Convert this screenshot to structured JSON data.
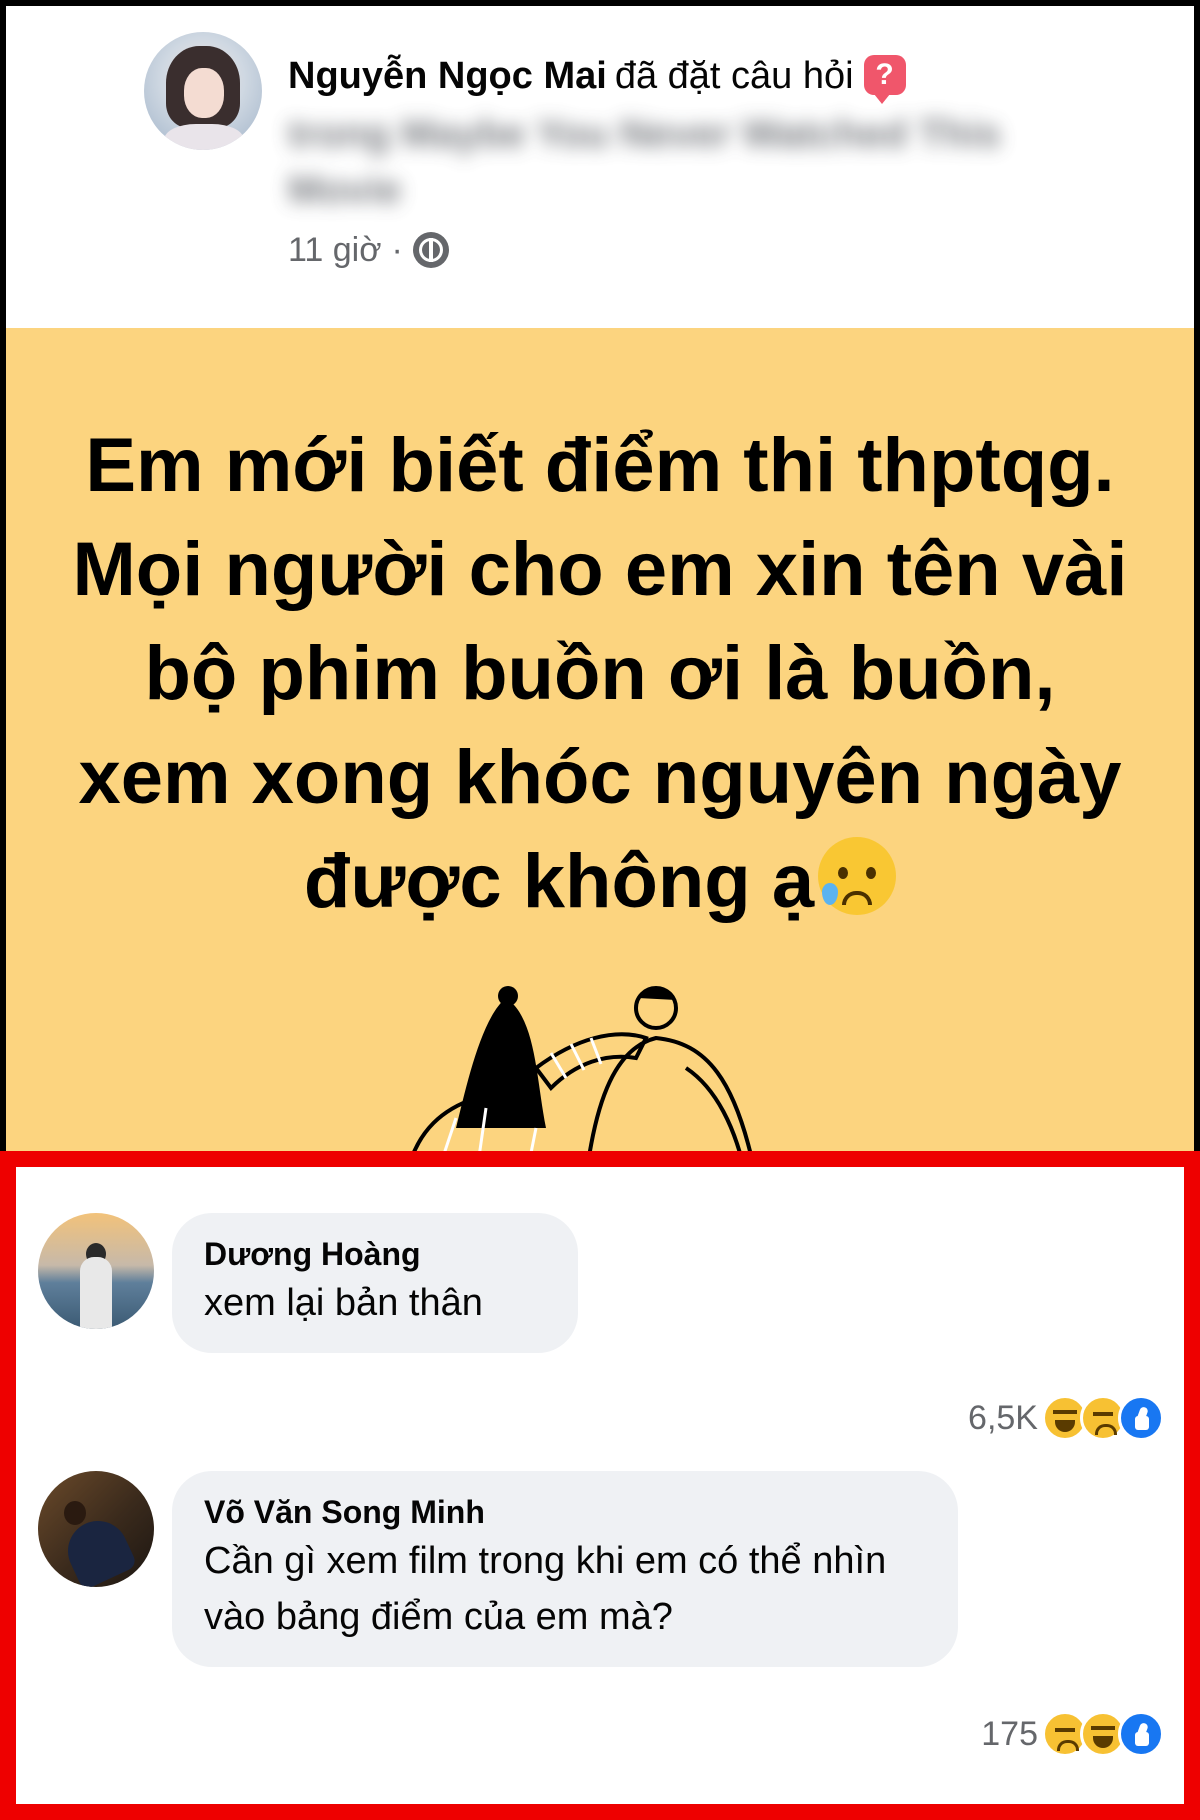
{
  "post": {
    "author_name": "Nguyễn Ngọc Mai",
    "action_text": "đã đặt câu hỏi",
    "badge_icon": "question-mark-icon",
    "badge_glyph": "?",
    "group_line": "trong Maybe You Never Watched This Movie",
    "time": "11 giờ",
    "separator": "·",
    "privacy_icon": "globe-icon"
  },
  "question": {
    "text": "Em mới biết điểm thi thptqg. Mọi người cho em xin tên vài bộ phim buồn ơi là buồn, xem xong khóc nguyên ngày được không ạ",
    "emoji_icon": "sad-but-relieved-emoji-icon",
    "background_color": "#fcd47f"
  },
  "comments": [
    {
      "name": "Dương Hoàng",
      "text": "xem lại bản thân",
      "reaction_count": "6,5K",
      "reactions": [
        "haha-icon",
        "sad-icon",
        "like-icon"
      ]
    },
    {
      "name": "Võ Văn Song Minh",
      "text": "Cần gì xem film trong khi em có thể nhìn vào bảng điểm của em mà?",
      "reaction_count": "175",
      "reactions": [
        "sad-icon",
        "haha-icon",
        "like-icon"
      ]
    }
  ],
  "colors": {
    "highlight_border": "#ee0000",
    "like_blue": "#1877f2",
    "bubble_bg": "#eff1f4"
  }
}
